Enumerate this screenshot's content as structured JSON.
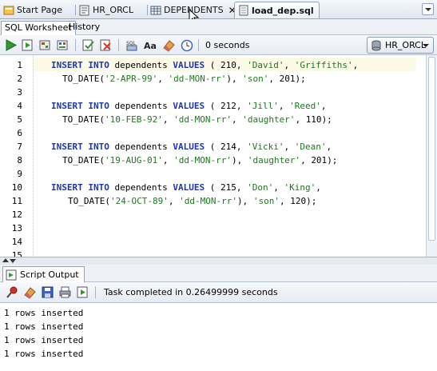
{
  "document_tabs": [
    {
      "label": "Start Page",
      "icon": "start-page-icon"
    },
    {
      "label": "HR_ORCL",
      "icon": "sql-sheet-icon"
    },
    {
      "label": "DEPENDENTS",
      "icon": "table-icon"
    },
    {
      "label": "load_dep.sql",
      "icon": "sql-file-icon"
    }
  ],
  "sub_tabs": [
    "SQL Worksheet",
    "History"
  ],
  "toolbar": {
    "elapsed": "0 seconds",
    "connection": "HR_ORCL"
  },
  "editor": {
    "line_numbers": [
      "1",
      "2",
      "3",
      "4",
      "5",
      "6",
      "7",
      "8",
      "9",
      "10",
      "11",
      "12",
      "13",
      "14",
      "15"
    ],
    "statements": [
      {
        "kw1": "INSERT",
        "kw2": "INTO",
        "table": "dependents",
        "kw3": "VALUES",
        "id": "210",
        "first": "'David'",
        "last": "'Griffiths'",
        "func": "TO_DATE",
        "date": "'2-APR-99'",
        "fmt": "'dd-MON-rr'",
        "rel": "'son'",
        "emp": "201"
      },
      {
        "kw1": "INSERT",
        "kw2": "INTO",
        "table": "dependents",
        "kw3": "VALUES",
        "id": "212",
        "first": "'Jill'",
        "last": "'Reed'",
        "func": "TO_DATE",
        "date": "'10-FEB-92'",
        "fmt": "'dd-MON-rr'",
        "rel": "'daughter'",
        "emp": "110"
      },
      {
        "kw1": "INSERT",
        "kw2": "INTO",
        "table": "dependents",
        "kw3": "VALUES",
        "id": "214",
        "first": "'Vicki'",
        "last": "'Dean'",
        "func": "TO_DATE",
        "date": "'19-AUG-01'",
        "fmt": "'dd-MON-rr'",
        "rel": "'daughter'",
        "emp": "201"
      },
      {
        "kw1": "INSERT",
        "kw2": "INTO",
        "table": "dependents",
        "kw3": "VALUES",
        "id": "215",
        "first": "'Don'",
        "last": "'King'",
        "func": "TO_DATE",
        "date": "'24-OCT-89'",
        "fmt": "'dd-MON-rr'",
        "rel": "'son'",
        "emp": "120"
      }
    ]
  },
  "output": {
    "tab_label": "Script Output",
    "status": "Task completed in 0.26499999 seconds",
    "lines": [
      "1 rows inserted",
      "1 rows inserted",
      "1 rows inserted",
      "1 rows inserted"
    ]
  },
  "colors": {
    "keyword": "#1c36b4",
    "string": "#1c7a1c",
    "current_line": "#fbfae6"
  }
}
